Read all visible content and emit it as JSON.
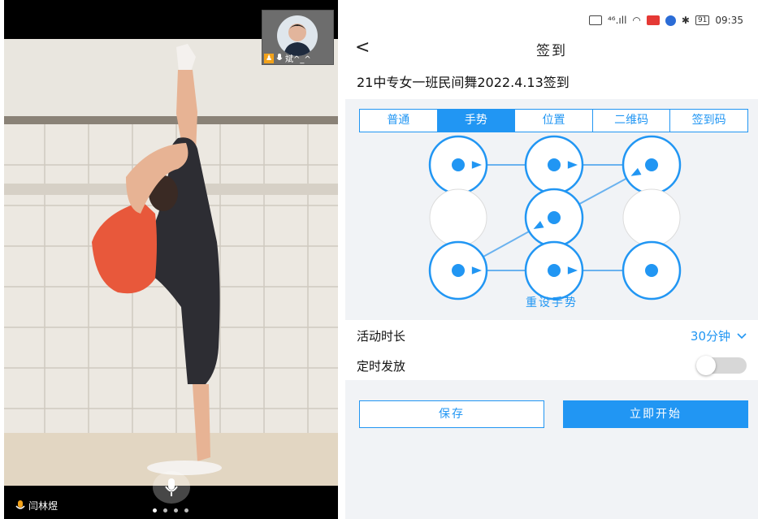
{
  "video_call": {
    "remote_participant_name": "斌^_^",
    "self_name": "闫林煜",
    "page_count": 4,
    "active_page": 1
  },
  "status_bar": {
    "signal": "⁴⁶.ıll",
    "battery": "91",
    "time": "09:35"
  },
  "nav": {
    "back_icon": "<",
    "title": "签到"
  },
  "activity_title": "21中专女一班民间舞2022.4.13签到",
  "tabs": [
    {
      "label": "普通",
      "active": false
    },
    {
      "label": "手势",
      "active": true
    },
    {
      "label": "位置",
      "active": false
    },
    {
      "label": "二维码",
      "active": false
    },
    {
      "label": "签到码",
      "active": false
    }
  ],
  "gesture": {
    "sequence": [
      1,
      2,
      3,
      5,
      7,
      8,
      9
    ],
    "reset_label": "重设手势"
  },
  "settings": {
    "duration_label": "活动时长",
    "duration_value": "30分钟",
    "timer_label": "定时发放",
    "timer_enabled": false
  },
  "buttons": {
    "save": "保存",
    "start": "立即开始"
  },
  "colors": {
    "accent": "#2196f3",
    "panel_bg": "#f1f3f6"
  }
}
